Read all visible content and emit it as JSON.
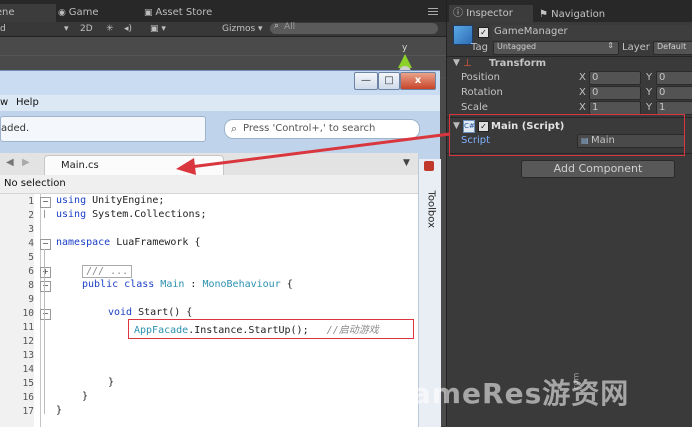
{
  "unity": {
    "tabs": {
      "scene": "Scene",
      "game": "Game",
      "asset_store": "Asset Store"
    },
    "toolbar": {
      "shading": "d",
      "mode_2d": "2D",
      "gizmos": "Gizmos",
      "search_placeholder": "All"
    },
    "gizmo": {
      "axis_label": "y"
    }
  },
  "vs": {
    "menu": {
      "view_fragment": "w",
      "help": "Help"
    },
    "status_text": "aded.",
    "search_placeholder": "Press 'Control+,' to search",
    "file_tab": "Main.cs",
    "crumb": "No selection",
    "toolbox": "Toolbox",
    "window_buttons": {
      "minimize": "—",
      "maximize": "□",
      "close": "x"
    }
  },
  "code": {
    "lines": [
      {
        "n": "1",
        "text": "using UnityEngine;"
      },
      {
        "n": "2",
        "text": "using System.Collections;"
      },
      {
        "n": "3",
        "text": ""
      },
      {
        "n": "4",
        "text": "namespace LuaFramework {"
      },
      {
        "n": "5",
        "text": ""
      },
      {
        "n": "6",
        "text": "/// ..."
      },
      {
        "n": "8",
        "text": "public class Main : MonoBehaviour {"
      },
      {
        "n": "9",
        "text": ""
      },
      {
        "n": "10",
        "text": "void Start() {"
      },
      {
        "n": "11",
        "text": "AppFacade.Instance.StartUp();"
      },
      {
        "n": "12",
        "text": ""
      },
      {
        "n": "13",
        "text": ""
      },
      {
        "n": "14",
        "text": ""
      },
      {
        "n": "15",
        "text": "}"
      },
      {
        "n": "16",
        "text": "}"
      },
      {
        "n": "17",
        "text": "}"
      }
    ],
    "comment": "//启动游戏"
  },
  "inspector": {
    "tabs": {
      "inspector": "Inspector",
      "navigation": "Navigation"
    },
    "object_name": "GameManager",
    "tag_label": "Tag",
    "tag_value": "Untagged",
    "layer_label": "Layer",
    "layer_value": "Default",
    "transform": {
      "title": "Transform",
      "rows": [
        {
          "label": "Position",
          "x": "0",
          "y": "0"
        },
        {
          "label": "Rotation",
          "x": "0",
          "y": "0"
        },
        {
          "label": "Scale",
          "x": "1",
          "y": "1"
        }
      ],
      "x_label": "X",
      "y_label": "Y"
    },
    "script_component": {
      "title": "Main (Script)",
      "field_label": "Script",
      "field_value": "Main"
    },
    "add_component": "Add Component"
  },
  "watermark": "GameRes游资网",
  "watermark_com": ".com",
  "colors": {
    "annotation_red": "#d9363e",
    "unity_bg": "#474747",
    "vs_chrome": "#bfd3ea"
  }
}
